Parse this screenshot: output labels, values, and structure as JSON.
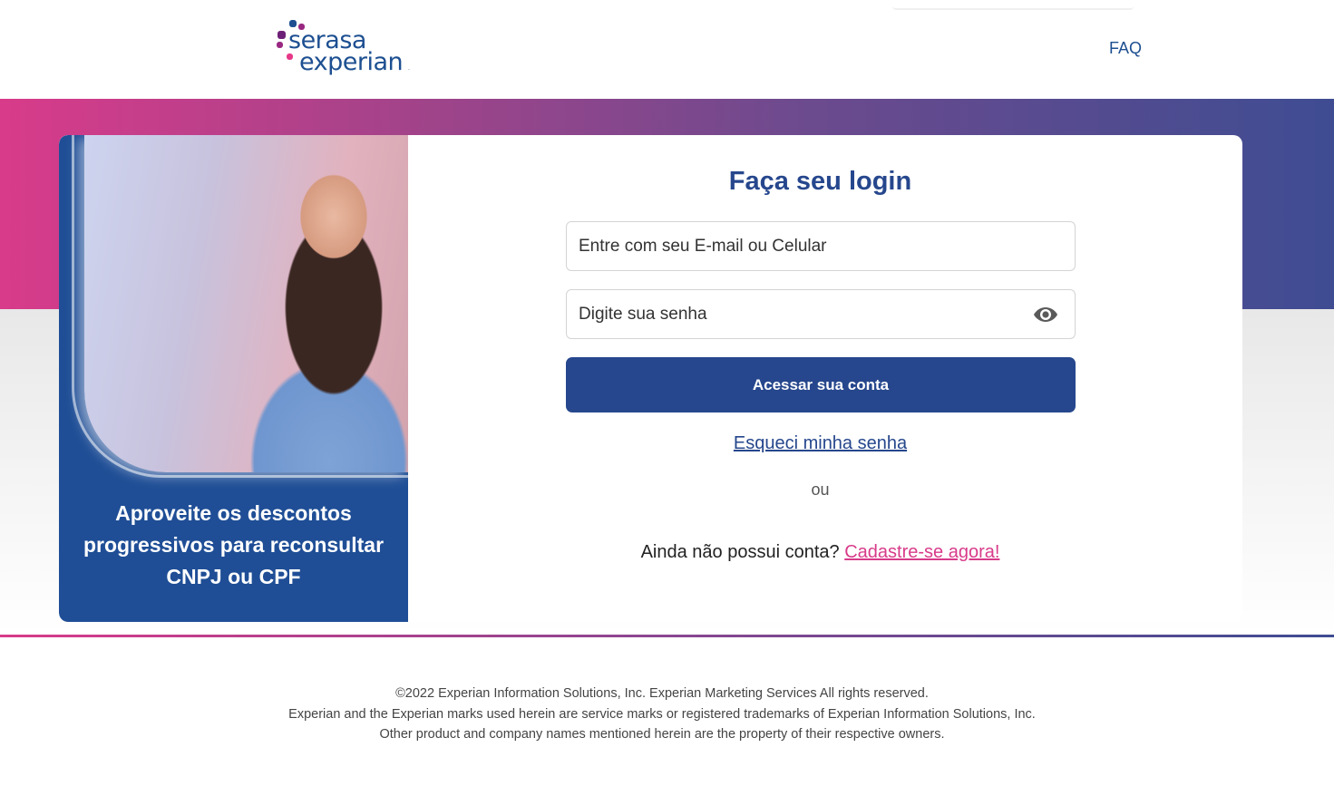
{
  "header": {
    "logo_line1": "serasa",
    "logo_line2": "experian",
    "logo_tm": ".",
    "faq_label": "FAQ"
  },
  "colors": {
    "brand_blue": "#26478d",
    "brand_pink": "#d83b8a",
    "gradient_end": "#3f4c92"
  },
  "promo": {
    "text": "Aproveite os descontos progressivos para reconsultar CNPJ ou CPF"
  },
  "login": {
    "title": "Faça seu login",
    "email_placeholder": "Entre com seu E-mail ou Celular",
    "password_placeholder": "Digite sua senha",
    "submit_label": "Acessar sua conta",
    "forgot_label": "Esqueci minha senha",
    "or_label": "ou",
    "no_account_text": "Ainda não possui conta? ",
    "signup_link": "Cadastre-se agora!",
    "eye_icon": "eye-icon"
  },
  "footer": {
    "line1": "©2022 Experian Information Solutions, Inc. Experian Marketing Services All rights reserved.",
    "line2": "Experian and the Experian marks used herein are service marks or registered trademarks of Experian Information Solutions, Inc.",
    "line3": "Other product and company names mentioned herein are the property of their respective owners."
  }
}
